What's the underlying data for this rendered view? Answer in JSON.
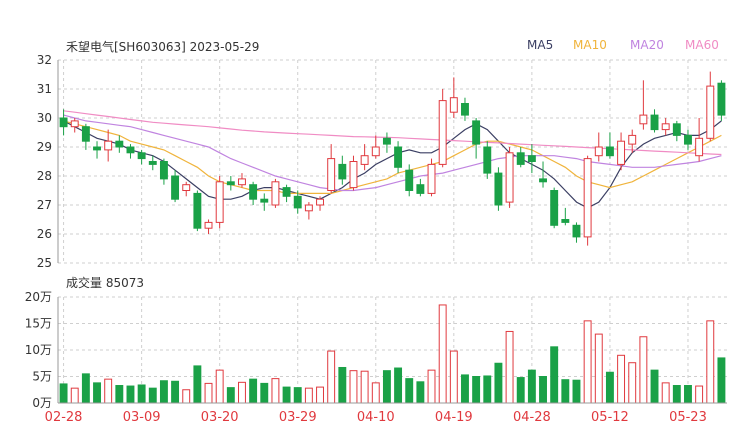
{
  "header": {
    "title": "禾望电气[SH603063] 2023-05-29",
    "vol_label": "成交量",
    "vol_value": "85073"
  },
  "legend": [
    {
      "label": "MA5",
      "color": "#3b3f63"
    },
    {
      "label": "MA10",
      "color": "#f0b43c"
    },
    {
      "label": "MA20",
      "color": "#c084e0"
    },
    {
      "label": "MA60",
      "color": "#f08cc4"
    }
  ],
  "colors": {
    "up": "#e0393e",
    "down": "#1aa147",
    "grid": "#cfcfcf"
  },
  "chart_data": [
    {
      "type": "candlestick",
      "title": "禾望电气[SH603063] 2023-05-29",
      "ylim": [
        25,
        32
      ],
      "yticks": [
        "25",
        "26",
        "27",
        "28",
        "29",
        "30",
        "31",
        "32"
      ],
      "x_labels": [
        "02-28",
        "03-09",
        "03-20",
        "03-29",
        "04-10",
        "04-19",
        "04-28",
        "05-12",
        "05-23"
      ],
      "x_label_index": [
        0,
        7,
        14,
        21,
        28,
        35,
        42,
        49,
        56
      ],
      "candles": [
        {
          "o": 30.0,
          "c": 29.7,
          "h": 30.3,
          "l": 29.4
        },
        {
          "o": 29.7,
          "c": 29.9,
          "h": 30.0,
          "l": 29.5
        },
        {
          "o": 29.7,
          "c": 29.2,
          "h": 29.8,
          "l": 28.9
        },
        {
          "o": 29.0,
          "c": 28.9,
          "h": 29.2,
          "l": 28.6
        },
        {
          "o": 28.9,
          "c": 29.2,
          "h": 29.6,
          "l": 28.5
        },
        {
          "o": 29.2,
          "c": 29.0,
          "h": 29.4,
          "l": 28.8
        },
        {
          "o": 29.0,
          "c": 28.8,
          "h": 29.1,
          "l": 28.6
        },
        {
          "o": 28.8,
          "c": 28.6,
          "h": 28.9,
          "l": 28.4
        },
        {
          "o": 28.5,
          "c": 28.4,
          "h": 28.7,
          "l": 28.2
        },
        {
          "o": 28.5,
          "c": 27.9,
          "h": 28.6,
          "l": 27.7
        },
        {
          "o": 28.0,
          "c": 27.2,
          "h": 28.2,
          "l": 27.1
        },
        {
          "o": 27.5,
          "c": 27.7,
          "h": 27.8,
          "l": 27.3
        },
        {
          "o": 27.4,
          "c": 26.2,
          "h": 27.5,
          "l": 26.1
        },
        {
          "o": 26.2,
          "c": 26.4,
          "h": 26.5,
          "l": 26.0
        },
        {
          "o": 26.4,
          "c": 27.8,
          "h": 28.0,
          "l": 26.2
        },
        {
          "o": 27.8,
          "c": 27.7,
          "h": 28.0,
          "l": 27.5
        },
        {
          "o": 27.7,
          "c": 27.9,
          "h": 28.1,
          "l": 27.6
        },
        {
          "o": 27.7,
          "c": 27.2,
          "h": 27.8,
          "l": 27.0
        },
        {
          "o": 27.2,
          "c": 27.1,
          "h": 27.4,
          "l": 26.8
        },
        {
          "o": 27.0,
          "c": 27.8,
          "h": 27.9,
          "l": 26.9
        },
        {
          "o": 27.6,
          "c": 27.3,
          "h": 27.7,
          "l": 27.1
        },
        {
          "o": 27.3,
          "c": 26.9,
          "h": 27.5,
          "l": 26.7
        },
        {
          "o": 26.8,
          "c": 27.0,
          "h": 27.1,
          "l": 26.5
        },
        {
          "o": 27.0,
          "c": 27.2,
          "h": 27.3,
          "l": 26.8
        },
        {
          "o": 27.5,
          "c": 28.6,
          "h": 29.1,
          "l": 27.4
        },
        {
          "o": 28.4,
          "c": 27.9,
          "h": 28.7,
          "l": 27.7
        },
        {
          "o": 27.6,
          "c": 28.5,
          "h": 28.7,
          "l": 27.5
        },
        {
          "o": 28.4,
          "c": 28.7,
          "h": 29.1,
          "l": 28.2
        },
        {
          "o": 28.7,
          "c": 29.0,
          "h": 29.4,
          "l": 28.6
        },
        {
          "o": 29.3,
          "c": 29.1,
          "h": 29.5,
          "l": 28.8
        },
        {
          "o": 29.0,
          "c": 28.3,
          "h": 29.2,
          "l": 28.1
        },
        {
          "o": 28.2,
          "c": 27.5,
          "h": 28.4,
          "l": 27.3
        },
        {
          "o": 27.7,
          "c": 27.4,
          "h": 27.9,
          "l": 27.3
        },
        {
          "o": 27.4,
          "c": 28.4,
          "h": 28.6,
          "l": 27.3
        },
        {
          "o": 28.4,
          "c": 30.6,
          "h": 31.0,
          "l": 28.3
        },
        {
          "o": 30.2,
          "c": 30.7,
          "h": 31.4,
          "l": 30.0
        },
        {
          "o": 30.5,
          "c": 30.1,
          "h": 30.7,
          "l": 29.9
        },
        {
          "o": 29.9,
          "c": 29.1,
          "h": 30.0,
          "l": 28.6
        },
        {
          "o": 29.0,
          "c": 28.1,
          "h": 29.2,
          "l": 27.9
        },
        {
          "o": 28.1,
          "c": 27.0,
          "h": 28.3,
          "l": 26.8
        },
        {
          "o": 27.1,
          "c": 28.8,
          "h": 29.0,
          "l": 26.9
        },
        {
          "o": 28.8,
          "c": 28.4,
          "h": 29.0,
          "l": 28.3
        },
        {
          "o": 28.7,
          "c": 28.5,
          "h": 29.1,
          "l": 28.1
        },
        {
          "o": 27.9,
          "c": 27.8,
          "h": 28.5,
          "l": 27.6
        },
        {
          "o": 27.5,
          "c": 26.3,
          "h": 27.6,
          "l": 26.2
        },
        {
          "o": 26.5,
          "c": 26.4,
          "h": 26.9,
          "l": 26.3
        },
        {
          "o": 26.3,
          "c": 25.9,
          "h": 26.4,
          "l": 25.7
        },
        {
          "o": 25.9,
          "c": 28.6,
          "h": 28.7,
          "l": 25.6
        },
        {
          "o": 28.7,
          "c": 29.0,
          "h": 29.5,
          "l": 28.5
        },
        {
          "o": 29.0,
          "c": 28.7,
          "h": 29.5,
          "l": 28.6
        },
        {
          "o": 28.4,
          "c": 29.2,
          "h": 29.5,
          "l": 28.2
        },
        {
          "o": 29.1,
          "c": 29.4,
          "h": 29.6,
          "l": 28.8
        },
        {
          "o": 29.8,
          "c": 30.1,
          "h": 31.3,
          "l": 29.6
        },
        {
          "o": 30.1,
          "c": 29.6,
          "h": 30.3,
          "l": 29.5
        },
        {
          "o": 29.6,
          "c": 29.8,
          "h": 30.0,
          "l": 29.4
        },
        {
          "o": 29.8,
          "c": 29.4,
          "h": 29.9,
          "l": 29.2
        },
        {
          "o": 29.4,
          "c": 29.1,
          "h": 29.6,
          "l": 28.9
        },
        {
          "o": 28.7,
          "c": 29.3,
          "h": 30.0,
          "l": 28.5
        },
        {
          "o": 29.3,
          "c": 31.1,
          "h": 31.6,
          "l": 29.2
        },
        {
          "o": 31.2,
          "c": 30.1,
          "h": 31.3,
          "l": 29.9
        }
      ],
      "ma": {
        "MA5": [
          29.9,
          29.7,
          29.5,
          29.3,
          29.2,
          29.1,
          28.9,
          28.8,
          28.7,
          28.5,
          28.2,
          27.9,
          27.6,
          27.3,
          27.2,
          27.2,
          27.3,
          27.5,
          27.6,
          27.6,
          27.5,
          27.4,
          27.3,
          27.2,
          27.4,
          27.6,
          27.9,
          28.1,
          28.4,
          28.6,
          28.8,
          28.9,
          28.8,
          28.8,
          29.0,
          29.3,
          29.6,
          29.8,
          29.6,
          29.2,
          28.8,
          28.6,
          28.4,
          28.2,
          27.9,
          27.5,
          27.1,
          26.9,
          27.1,
          27.6,
          28.3,
          28.8,
          29.1,
          29.3,
          29.4,
          29.5,
          29.4,
          29.4,
          29.6,
          29.9
        ],
        "MA10": [
          29.9,
          29.8,
          29.7,
          29.6,
          29.5,
          29.4,
          29.2,
          29.1,
          29.0,
          28.9,
          28.7,
          28.5,
          28.3,
          28.0,
          27.8,
          27.7,
          27.6,
          27.5,
          27.5,
          27.5,
          27.4,
          27.4,
          27.4,
          27.4,
          27.4,
          27.5,
          27.6,
          27.7,
          27.8,
          27.9,
          28.1,
          28.2,
          28.3,
          28.4,
          28.5,
          28.7,
          28.9,
          29.1,
          29.2,
          29.2,
          29.1,
          29.0,
          28.9,
          28.7,
          28.5,
          28.3,
          28.0,
          27.8,
          27.7,
          27.6,
          27.7,
          27.8,
          28.0,
          28.2,
          28.4,
          28.6,
          28.8,
          29.0,
          29.2,
          29.4
        ],
        "MA20": [
          30.1,
          30.0,
          29.9,
          29.85,
          29.8,
          29.75,
          29.7,
          29.6,
          29.5,
          29.4,
          29.3,
          29.2,
          29.1,
          29.0,
          28.8,
          28.6,
          28.45,
          28.3,
          28.15,
          28.0,
          27.9,
          27.8,
          27.7,
          27.6,
          27.55,
          27.5,
          27.5,
          27.55,
          27.6,
          27.7,
          27.8,
          27.9,
          28.0,
          28.05,
          28.1,
          28.2,
          28.3,
          28.4,
          28.5,
          28.6,
          28.65,
          28.7,
          28.7,
          28.7,
          28.7,
          28.65,
          28.6,
          28.5,
          28.45,
          28.4,
          28.35,
          28.3,
          28.3,
          28.3,
          28.35,
          28.4,
          28.45,
          28.5,
          28.6,
          28.7
        ],
        "MA60": [
          30.25,
          30.2,
          30.15,
          30.1,
          30.05,
          30.0,
          29.95,
          29.9,
          29.85,
          29.82,
          29.79,
          29.76,
          29.73,
          29.7,
          29.66,
          29.62,
          29.58,
          29.55,
          29.52,
          29.5,
          29.48,
          29.46,
          29.44,
          29.42,
          29.4,
          29.38,
          29.36,
          29.35,
          29.34,
          29.33,
          29.32,
          29.3,
          29.28,
          29.26,
          29.24,
          29.22,
          29.2,
          29.18,
          29.16,
          29.14,
          29.12,
          29.1,
          29.08,
          29.06,
          29.04,
          29.02,
          29.0,
          28.98,
          28.96,
          28.94,
          28.92,
          28.9,
          28.88,
          28.86,
          28.84,
          28.82,
          28.8,
          28.78,
          28.76,
          28.74
        ]
      }
    },
    {
      "type": "bar",
      "title": "成交量 85073",
      "ylim": [
        0,
        200000
      ],
      "yticks": [
        "0万",
        "5万",
        "10万",
        "15万",
        "20万"
      ],
      "values": [
        36000,
        28000,
        55000,
        38000,
        45000,
        33000,
        32000,
        34000,
        28000,
        42000,
        41000,
        25000,
        70000,
        37000,
        62000,
        29000,
        39000,
        45000,
        37000,
        46000,
        30000,
        29000,
        28000,
        30000,
        98000,
        67000,
        61000,
        60000,
        38000,
        61000,
        66000,
        46000,
        40000,
        62000,
        185000,
        98000,
        53000,
        50000,
        51000,
        75000,
        135000,
        48000,
        62000,
        50000,
        106000,
        44000,
        43000,
        155000,
        130000,
        58000,
        90000,
        76000,
        125000,
        62000,
        38000,
        33000,
        33000,
        32000,
        155000,
        85073
      ]
    }
  ]
}
